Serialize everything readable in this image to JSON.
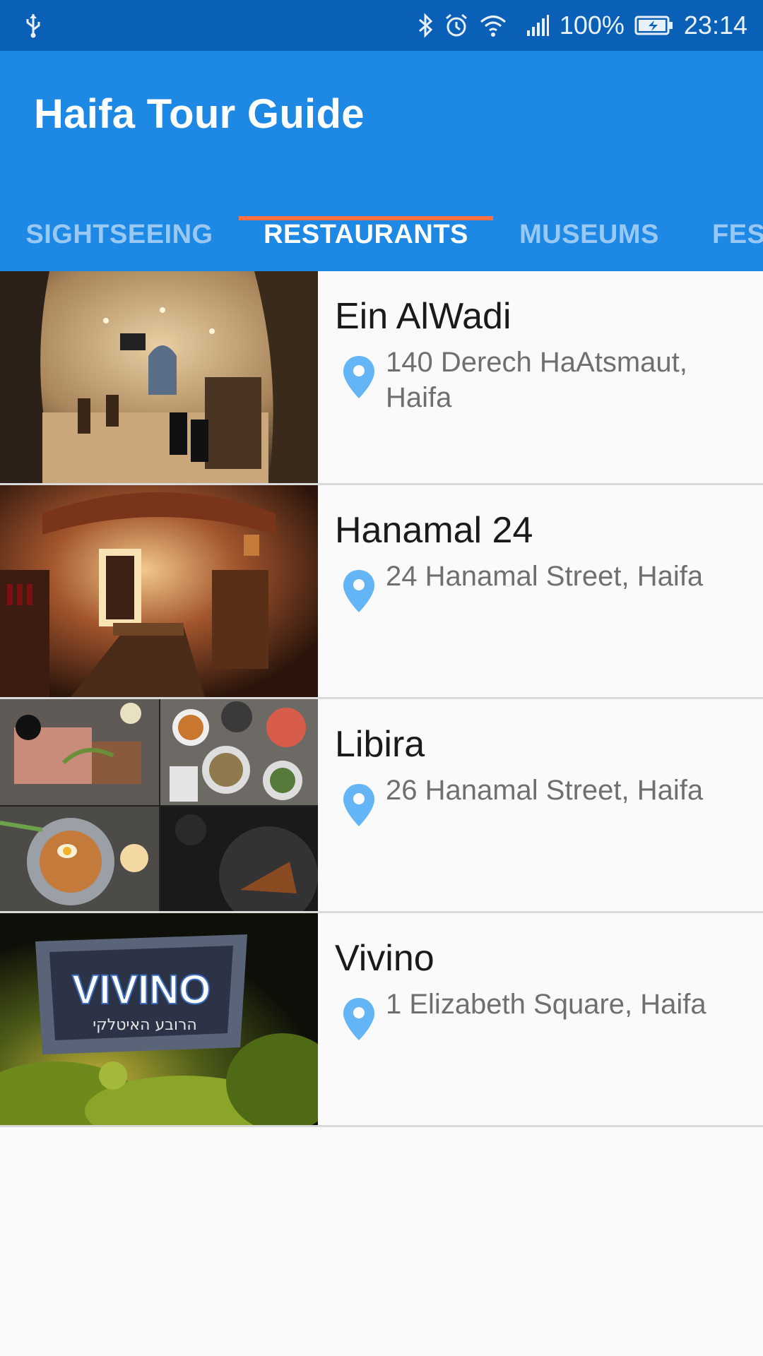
{
  "status_bar": {
    "battery_percent": "100%",
    "time": "23:14",
    "icons": [
      "usb-icon",
      "bluetooth-icon",
      "alarm-icon",
      "wifi-icon",
      "signal-icon",
      "battery-icon"
    ]
  },
  "app_bar": {
    "title": "Haifa Tour Guide",
    "color": "#1e88e5"
  },
  "tabs": [
    {
      "label": "SIGHTSEEING",
      "active": false
    },
    {
      "label": "RESTAURANTS",
      "active": true
    },
    {
      "label": "MUSEUMS",
      "active": false
    },
    {
      "label": "FES",
      "active": false
    }
  ],
  "accent_color": "#ff7043",
  "restaurants": [
    {
      "name": "Ein AlWadi",
      "address": "140 Derech HaAtsmaut, Haifa",
      "icon": "location-pin-icon"
    },
    {
      "name": "Hanamal 24",
      "address": "24 Hanamal Street, Haifa",
      "icon": "location-pin-icon"
    },
    {
      "name": "Libira",
      "address": "26 Hanamal Street, Haifa",
      "icon": "location-pin-icon"
    },
    {
      "name": "Vivino",
      "address": "1 Elizabeth Square, Haifa",
      "icon": "location-pin-icon"
    }
  ],
  "images": {
    "vivino_sign_text": "VIVINO",
    "vivino_sign_subtext": "הרובע האיטלקי"
  }
}
